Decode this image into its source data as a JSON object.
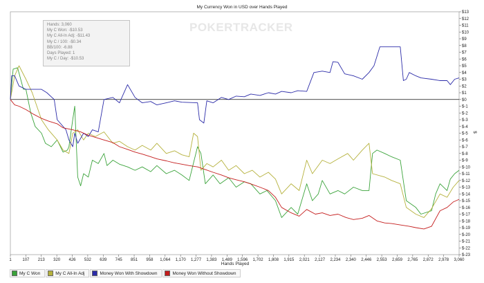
{
  "watermark": "POKERTRACKER",
  "stats": [
    "Hands: 3,060",
    "My C Won: -$10.53",
    "My C All-In Adj: -$11.43",
    "My C / 100: -$0.34",
    "BB/100: -6.88",
    "Days Played: 1",
    "My C / Day: -$10.53"
  ],
  "chart_data": {
    "type": "line",
    "title": "My Currency Won in USD over Hands Played",
    "xlabel": "Hands Played",
    "ylabel": "$",
    "xlim": [
      1,
      3060
    ],
    "ylim": [
      -23,
      13
    ],
    "x_ticks": [
      "1",
      "107",
      "213",
      "320",
      "426",
      "532",
      "639",
      "745",
      "851",
      "958",
      "1,064",
      "1,170",
      "1,277",
      "1,383",
      "1,489",
      "1,596",
      "1,702",
      "1,808",
      "1,915",
      "2,021",
      "2,127",
      "2,234",
      "2,340",
      "2,446",
      "2,553",
      "2,659",
      "2,765",
      "2,872",
      "2,978",
      "3,060"
    ],
    "y_ticks": [
      "$13",
      "$12",
      "$11",
      "$10",
      "$9",
      "$8",
      "$7",
      "$6",
      "$5",
      "$4",
      "$3",
      "$2",
      "$1",
      "$0",
      "$-1",
      "$-2",
      "$-3",
      "$-4",
      "$-5",
      "$-6",
      "$-7",
      "$-8",
      "$-9",
      "$-10",
      "$-11",
      "$-12",
      "$-13",
      "$-14",
      "$-15",
      "$-16",
      "$-17",
      "$-18",
      "$-19",
      "$-20",
      "$-21",
      "$-22",
      "$-23"
    ],
    "grid": false,
    "legend_position": "bottom",
    "series": [
      {
        "name": "My C Won",
        "color": "#3aa33a",
        "points": [
          [
            1,
            0
          ],
          [
            20,
            4.5
          ],
          [
            50,
            4.7
          ],
          [
            90,
            1.5
          ],
          [
            107,
            1.5
          ],
          [
            140,
            -2
          ],
          [
            170,
            -4
          ],
          [
            213,
            -5
          ],
          [
            240,
            -6.5
          ],
          [
            280,
            -7
          ],
          [
            320,
            -6
          ],
          [
            360,
            -7.8
          ],
          [
            390,
            -7.5
          ],
          [
            400,
            -7
          ],
          [
            426,
            -3
          ],
          [
            440,
            -1
          ],
          [
            460,
            -11.5
          ],
          [
            480,
            -12.8
          ],
          [
            500,
            -11
          ],
          [
            532,
            -11.5
          ],
          [
            560,
            -9
          ],
          [
            600,
            -9.5
          ],
          [
            639,
            -8
          ],
          [
            660,
            -9.8
          ],
          [
            700,
            -9
          ],
          [
            745,
            -9.6
          ],
          [
            800,
            -10
          ],
          [
            851,
            -10.5
          ],
          [
            900,
            -10
          ],
          [
            958,
            -10.7
          ],
          [
            1000,
            -9.8
          ],
          [
            1064,
            -11
          ],
          [
            1120,
            -10.5
          ],
          [
            1170,
            -11.2
          ],
          [
            1220,
            -12
          ],
          [
            1277,
            -7
          ],
          [
            1300,
            -8
          ],
          [
            1330,
            -12.5
          ],
          [
            1383,
            -11.2
          ],
          [
            1430,
            -12.5
          ],
          [
            1489,
            -11.6
          ],
          [
            1540,
            -13
          ],
          [
            1596,
            -12.2
          ],
          [
            1640,
            -12.5
          ],
          [
            1702,
            -14
          ],
          [
            1750,
            -13.5
          ],
          [
            1808,
            -15
          ],
          [
            1850,
            -17.5
          ],
          [
            1915,
            -16
          ],
          [
            1960,
            -17
          ],
          [
            2021,
            -12.5
          ],
          [
            2060,
            -15
          ],
          [
            2100,
            -14
          ],
          [
            2127,
            -12
          ],
          [
            2180,
            -14
          ],
          [
            2234,
            -13.5
          ],
          [
            2280,
            -14
          ],
          [
            2340,
            -13
          ],
          [
            2400,
            -13.5
          ],
          [
            2446,
            -13.5
          ],
          [
            2470,
            -8
          ],
          [
            2500,
            -7.5
          ],
          [
            2553,
            -8
          ],
          [
            2600,
            -8.5
          ],
          [
            2659,
            -9
          ],
          [
            2700,
            -15
          ],
          [
            2765,
            -16
          ],
          [
            2800,
            -17
          ],
          [
            2872,
            -16.5
          ],
          [
            2900,
            -14
          ],
          [
            2930,
            -12.5
          ],
          [
            2978,
            -13.5
          ],
          [
            3000,
            -11.8
          ],
          [
            3030,
            -11
          ],
          [
            3060,
            -10.5
          ]
        ]
      },
      {
        "name": "My C All-In Adj",
        "color": "#b5b13c",
        "points": [
          [
            1,
            0
          ],
          [
            30,
            3.5
          ],
          [
            60,
            5
          ],
          [
            107,
            3
          ],
          [
            150,
            1
          ],
          [
            213,
            -3
          ],
          [
            260,
            -4.5
          ],
          [
            320,
            -6
          ],
          [
            360,
            -7.5
          ],
          [
            400,
            -8
          ],
          [
            426,
            -5
          ],
          [
            460,
            -4.5
          ],
          [
            500,
            -6
          ],
          [
            532,
            -5
          ],
          [
            580,
            -5.5
          ],
          [
            639,
            -4.8
          ],
          [
            700,
            -6.5
          ],
          [
            745,
            -6.2
          ],
          [
            800,
            -7
          ],
          [
            851,
            -7.5
          ],
          [
            900,
            -6.8
          ],
          [
            958,
            -7.5
          ],
          [
            1000,
            -6.5
          ],
          [
            1064,
            -8
          ],
          [
            1120,
            -7.6
          ],
          [
            1170,
            -8.2
          ],
          [
            1220,
            -8.5
          ],
          [
            1250,
            -5
          ],
          [
            1277,
            -5.5
          ],
          [
            1300,
            -10.5
          ],
          [
            1340,
            -9.5
          ],
          [
            1383,
            -10
          ],
          [
            1440,
            -9
          ],
          [
            1489,
            -10.5
          ],
          [
            1540,
            -9.8
          ],
          [
            1596,
            -11
          ],
          [
            1650,
            -10.5
          ],
          [
            1702,
            -11.5
          ],
          [
            1760,
            -10.8
          ],
          [
            1808,
            -11.8
          ],
          [
            1850,
            -14
          ],
          [
            1915,
            -12.5
          ],
          [
            1970,
            -13.5
          ],
          [
            2021,
            -9
          ],
          [
            2060,
            -11
          ],
          [
            2127,
            -9
          ],
          [
            2180,
            -9.5
          ],
          [
            2234,
            -8.8
          ],
          [
            2300,
            -8
          ],
          [
            2340,
            -9
          ],
          [
            2400,
            -7.5
          ],
          [
            2446,
            -6.5
          ],
          [
            2470,
            -11
          ],
          [
            2553,
            -11.5
          ],
          [
            2600,
            -12
          ],
          [
            2659,
            -12.5
          ],
          [
            2700,
            -16
          ],
          [
            2765,
            -17
          ],
          [
            2820,
            -17.5
          ],
          [
            2872,
            -16.2
          ],
          [
            2930,
            -14
          ],
          [
            2978,
            -14.5
          ],
          [
            3020,
            -13
          ],
          [
            3060,
            -12
          ]
        ]
      },
      {
        "name": "Money Won With Showdown",
        "color": "#2b2ba8",
        "points": [
          [
            1,
            0
          ],
          [
            10,
            3.5
          ],
          [
            30,
            3.5
          ],
          [
            60,
            2
          ],
          [
            107,
            1.5
          ],
          [
            213,
            1.5
          ],
          [
            250,
            1
          ],
          [
            300,
            0
          ],
          [
            320,
            -3
          ],
          [
            380,
            -4.5
          ],
          [
            400,
            -6
          ],
          [
            426,
            -7
          ],
          [
            440,
            -5
          ],
          [
            460,
            -6.5
          ],
          [
            500,
            -5
          ],
          [
            532,
            -5.5
          ],
          [
            560,
            -4.5
          ],
          [
            600,
            -4.8
          ],
          [
            639,
            0
          ],
          [
            700,
            0.3
          ],
          [
            745,
            -0.5
          ],
          [
            800,
            2.2
          ],
          [
            851,
            0.3
          ],
          [
            900,
            -0.5
          ],
          [
            958,
            -0.3
          ],
          [
            1000,
            -0.8
          ],
          [
            1064,
            -0.5
          ],
          [
            1120,
            -0.2
          ],
          [
            1170,
            -0.4
          ],
          [
            1277,
            -0.5
          ],
          [
            1290,
            -3
          ],
          [
            1320,
            -3.5
          ],
          [
            1340,
            -0.2
          ],
          [
            1383,
            -0.5
          ],
          [
            1440,
            0.3
          ],
          [
            1489,
            0
          ],
          [
            1540,
            0.5
          ],
          [
            1596,
            0.4
          ],
          [
            1640,
            0.8
          ],
          [
            1702,
            0.6
          ],
          [
            1760,
            1
          ],
          [
            1808,
            0.8
          ],
          [
            1850,
            1.2
          ],
          [
            1915,
            1
          ],
          [
            1960,
            1.3
          ],
          [
            2021,
            1.2
          ],
          [
            2070,
            4
          ],
          [
            2127,
            4.2
          ],
          [
            2180,
            4
          ],
          [
            2200,
            5.6
          ],
          [
            2234,
            5.5
          ],
          [
            2280,
            3.8
          ],
          [
            2340,
            3.5
          ],
          [
            2400,
            3
          ],
          [
            2446,
            4
          ],
          [
            2480,
            5
          ],
          [
            2520,
            7.8
          ],
          [
            2553,
            7.8
          ],
          [
            2659,
            7.8
          ],
          [
            2680,
            2.8
          ],
          [
            2700,
            3
          ],
          [
            2720,
            4
          ],
          [
            2765,
            3.5
          ],
          [
            2800,
            3.2
          ],
          [
            2872,
            3
          ],
          [
            2930,
            2.8
          ],
          [
            2978,
            2.8
          ],
          [
            3000,
            2.2
          ],
          [
            3030,
            3
          ],
          [
            3060,
            3.2
          ]
        ]
      },
      {
        "name": "Money Won Without Showdown",
        "color": "#c41c1c",
        "points": [
          [
            1,
            0
          ],
          [
            30,
            -0.8
          ],
          [
            60,
            -1
          ],
          [
            107,
            -1.5
          ],
          [
            160,
            -2.2
          ],
          [
            213,
            -2.8
          ],
          [
            260,
            -3.2
          ],
          [
            320,
            -3.6
          ],
          [
            360,
            -4.2
          ],
          [
            426,
            -4.5
          ],
          [
            480,
            -4.8
          ],
          [
            532,
            -5.3
          ],
          [
            580,
            -5.6
          ],
          [
            639,
            -6
          ],
          [
            700,
            -6.4
          ],
          [
            745,
            -7
          ],
          [
            800,
            -7.4
          ],
          [
            851,
            -7.8
          ],
          [
            900,
            -8.1
          ],
          [
            958,
            -8.5
          ],
          [
            1000,
            -8.8
          ],
          [
            1064,
            -9.1
          ],
          [
            1120,
            -9.4
          ],
          [
            1170,
            -9.6
          ],
          [
            1220,
            -9.8
          ],
          [
            1277,
            -10
          ],
          [
            1330,
            -10.4
          ],
          [
            1383,
            -10.8
          ],
          [
            1440,
            -11.2
          ],
          [
            1489,
            -11.6
          ],
          [
            1540,
            -11.9
          ],
          [
            1596,
            -12.2
          ],
          [
            1650,
            -12.6
          ],
          [
            1702,
            -13
          ],
          [
            1760,
            -13.5
          ],
          [
            1808,
            -14.5
          ],
          [
            1850,
            -16
          ],
          [
            1915,
            -16.8
          ],
          [
            1970,
            -17.3
          ],
          [
            2021,
            -16.3
          ],
          [
            2080,
            -17
          ],
          [
            2127,
            -16.8
          ],
          [
            2180,
            -17.2
          ],
          [
            2234,
            -17
          ],
          [
            2290,
            -17.5
          ],
          [
            2340,
            -17.8
          ],
          [
            2400,
            -17.6
          ],
          [
            2446,
            -17.2
          ],
          [
            2500,
            -18
          ],
          [
            2553,
            -18.3
          ],
          [
            2600,
            -18.4
          ],
          [
            2659,
            -18.6
          ],
          [
            2720,
            -18.8
          ],
          [
            2765,
            -19
          ],
          [
            2820,
            -19.2
          ],
          [
            2872,
            -18.8
          ],
          [
            2930,
            -16.5
          ],
          [
            2978,
            -16
          ],
          [
            3020,
            -15.2
          ],
          [
            3060,
            -14.8
          ]
        ]
      }
    ]
  }
}
